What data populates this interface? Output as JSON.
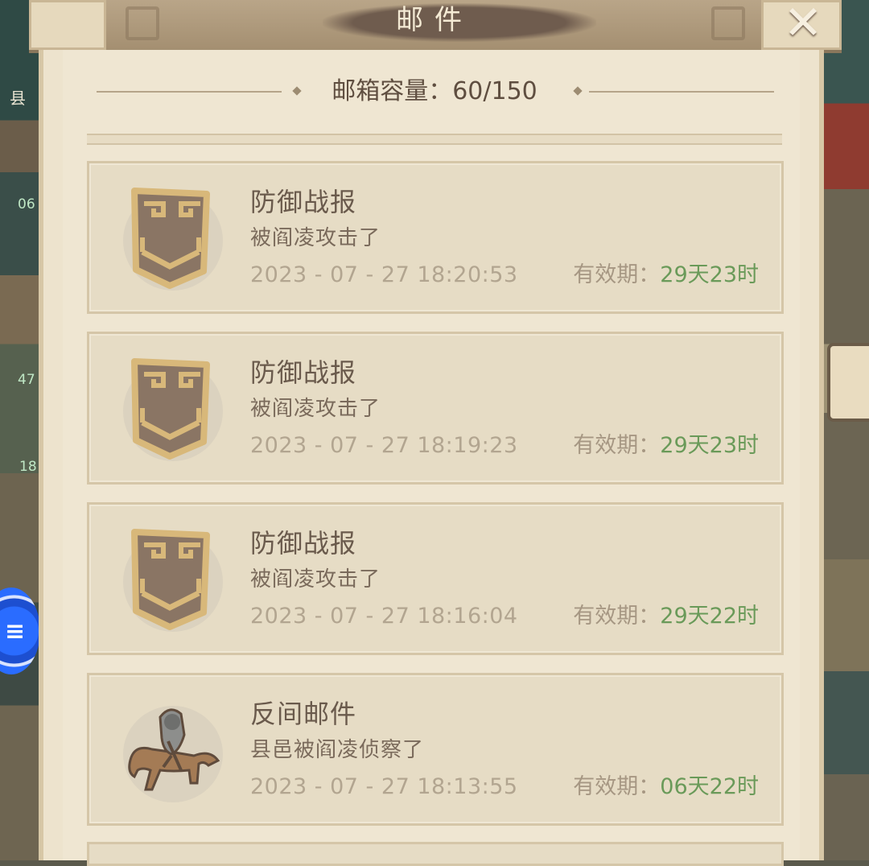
{
  "window": {
    "title": "邮件",
    "close_icon": "close-icon"
  },
  "background": {
    "left_label": "县",
    "left_numbers": [
      "06",
      "47",
      "18"
    ]
  },
  "mailbox": {
    "capacity_label": "邮箱容量：60/150"
  },
  "mails": [
    {
      "icon": "shield-icon",
      "title": "防御战报",
      "subtitle": "被阎凌攻击了",
      "time": "2023 - 07 - 27   18:20:53",
      "validity_label": "有效期：",
      "validity_value": "29天23时"
    },
    {
      "icon": "shield-icon",
      "title": "防御战报",
      "subtitle": "被阎凌攻击了",
      "time": "2023 - 07 - 27   18:19:23",
      "validity_label": "有效期：",
      "validity_value": "29天23时"
    },
    {
      "icon": "shield-icon",
      "title": "防御战报",
      "subtitle": "被阎凌攻击了",
      "time": "2023 - 07 - 27   18:16:04",
      "validity_label": "有效期：",
      "validity_value": "29天22时"
    },
    {
      "icon": "spy-rider-icon",
      "title": "反间邮件",
      "subtitle": "县邑被阎凌侦察了",
      "time": "2023 - 07 - 27   18:13:55",
      "validity_label": "有效期：",
      "validity_value": "06天22时"
    }
  ],
  "colors": {
    "validity_green": "#6a9a59",
    "panel_bg": "#efe6d2",
    "header_bg": "#a48f71"
  }
}
